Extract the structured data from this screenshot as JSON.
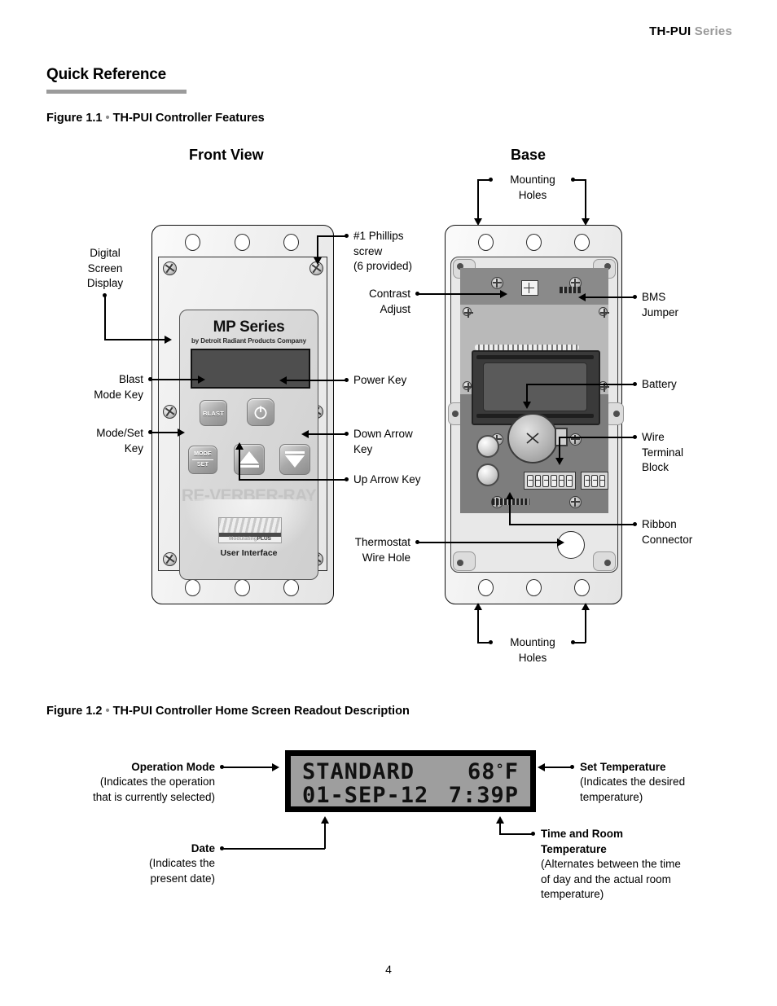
{
  "header": {
    "brand": "TH-PUI",
    "series": "Series"
  },
  "section": {
    "title": "Quick Reference"
  },
  "figure1": {
    "caption_label": "Figure 1.1",
    "caption_sep": "•",
    "caption_text": "TH-PUI Controller Features",
    "front_view_title": "Front View",
    "base_title": "Base",
    "front_labels": {
      "digital_screen_display": "Digital\nScreen\nDisplay",
      "blast_mode_key": "Blast\nMode Key",
      "mode_set_key": "Mode/Set\nKey",
      "phillips_screw": "#1 Phillips\nscrew\n(6 provided)",
      "power_key": "Power Key",
      "down_arrow_key": "Down Arrow\nKey",
      "up_arrow_key": "Up Arrow Key",
      "thermostat_wire_hole": "Thermostat\nWire Hole"
    },
    "base_labels": {
      "mounting_holes_top": "Mounting\nHoles",
      "mounting_holes_bottom": "Mounting\nHoles",
      "contrast_adjust": "Contrast\nAdjust",
      "bms_jumper": "BMS\nJumper",
      "battery": "Battery",
      "wire_terminal_block": "Wire\nTerminal\nBlock",
      "ribbon_connector": "Ribbon\nConnector"
    },
    "faceplate": {
      "brand_title": "MP Series",
      "brand_subtitle": "by Detroit Radiant Products Company",
      "blast_key_label": "BLAST",
      "mode_key_label_top": "MODE",
      "mode_key_label_bottom": "SET",
      "watermark": "RE-VERBER-RAY",
      "badge_light": "Modulating",
      "badge_bold": "PLUS",
      "user_interface": "User Interface"
    }
  },
  "figure2": {
    "caption_label": "Figure 1.2",
    "caption_sep": "•",
    "caption_text": "TH-PUI Controller Home Screen Readout Description",
    "lcd": {
      "line1_left": "STANDARD",
      "line1_right_value": "68",
      "line1_right_degree": "°",
      "line1_right_unit": "F",
      "line2_left": "01-SEP-12",
      "line2_right": "7:39P"
    },
    "labels": {
      "operation_mode_title": "Operation Mode",
      "operation_mode_desc": "(Indicates the operation\nthat is currently selected)",
      "date_title": "Date",
      "date_desc": "(Indicates the\npresent date)",
      "set_temperature_title": "Set Temperature",
      "set_temperature_desc": "(Indicates the desired\ntemperature)",
      "time_room_title": "Time and Room\nTemperature",
      "time_room_desc": "(Alternates between the time\nof day and the actual room\ntemperature)"
    }
  },
  "footer": {
    "page_number": "4"
  }
}
